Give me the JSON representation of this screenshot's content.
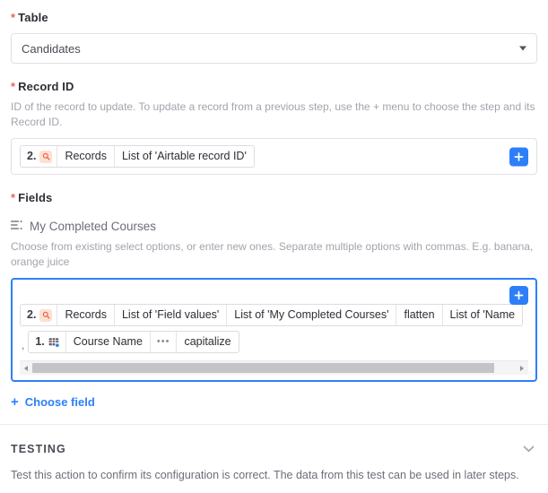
{
  "table_field": {
    "required_marker": "*",
    "label": "Table",
    "value": "Candidates",
    "caret_icon": "chevron-down-icon"
  },
  "record_id_field": {
    "required_marker": "*",
    "label": "Record ID",
    "help": "ID of the record to update. To update a record from a previous step, use the + menu to choose the step and its Record ID.",
    "token": {
      "step_number": "2.",
      "app_icon": "airtable-search-icon",
      "segments": [
        "Records",
        "List of 'Airtable record ID'"
      ]
    },
    "add_button_icon": "plus-icon"
  },
  "fields_section": {
    "required_marker": "*",
    "label": "Fields",
    "subfield": {
      "icon": "multi-select-icon",
      "name": "My Completed Courses",
      "help": "Choose from existing select options, or enter new ones. Separate multiple options with commas. E.g. banana, orange juice",
      "add_button_icon": "plus-icon",
      "tokens": [
        {
          "step_number": "2.",
          "app_icon": "airtable-search-icon",
          "segments": [
            "Records",
            "List of 'Field values'",
            "List of 'My Completed Courses'",
            "flatten",
            "List of 'Name"
          ]
        },
        {
          "separator": ",",
          "step_number": "1.",
          "app_icon": "table-grid-icon",
          "segments": [
            "Course Name",
            "•••",
            "capitalize"
          ]
        }
      ],
      "scrollbar": {
        "left_arrow_icon": "scroll-left-arrow-icon",
        "right_arrow_icon": "scroll-right-arrow-icon"
      }
    },
    "choose_field_link": {
      "plus": "+",
      "label": "Choose field"
    }
  },
  "testing_section": {
    "title": "TESTING",
    "chevron_icon": "chevron-down-icon",
    "description": "Test this action to confirm its configuration is correct. The data from this test can be used in later steps."
  },
  "colors": {
    "accent_blue": "#2d7ff9",
    "required_red": "#e8655a",
    "airtable_orange": "#fde0d4",
    "muted_text": "#a3a3ad"
  }
}
